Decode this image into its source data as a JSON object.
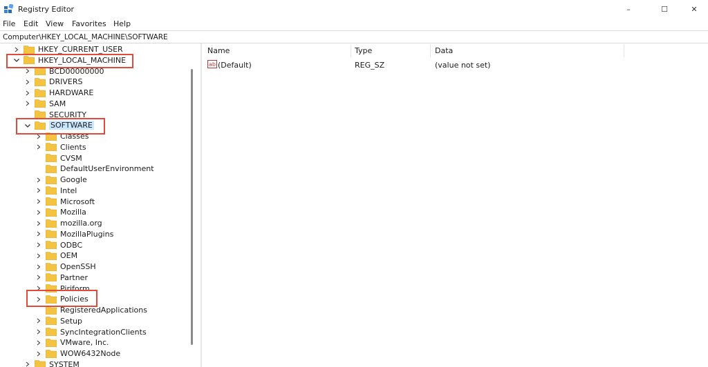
{
  "window": {
    "title": "Registry Editor",
    "controls": {
      "minimize": "–",
      "maximize": "☐",
      "close": "✕"
    }
  },
  "menu": [
    "File",
    "Edit",
    "View",
    "Favorites",
    "Help"
  ],
  "address": "Computer\\HKEY_LOCAL_MACHINE\\SOFTWARE",
  "tree": {
    "items": [
      {
        "label": "HKEY_CURRENT_USER",
        "expanded": false
      },
      {
        "label": "HKEY_LOCAL_MACHINE",
        "expanded": true
      },
      {
        "label": "BCD00000000",
        "expanded": false
      },
      {
        "label": "DRIVERS",
        "expanded": false
      },
      {
        "label": "HARDWARE",
        "expanded": false
      },
      {
        "label": "SAM",
        "expanded": false
      },
      {
        "label": "SECURITY",
        "expanded": false
      },
      {
        "label": "SOFTWARE",
        "expanded": true,
        "selected": true
      },
      {
        "label": "Classes",
        "expanded": false
      },
      {
        "label": "Clients",
        "expanded": false
      },
      {
        "label": "CVSM",
        "expanded": false
      },
      {
        "label": "DefaultUserEnvironment",
        "expanded": false
      },
      {
        "label": "Google",
        "expanded": false
      },
      {
        "label": "Intel",
        "expanded": false
      },
      {
        "label": "Microsoft",
        "expanded": false
      },
      {
        "label": "Mozilla",
        "expanded": false
      },
      {
        "label": "mozilla.org",
        "expanded": false
      },
      {
        "label": "MozillaPlugins",
        "expanded": false
      },
      {
        "label": "ODBC",
        "expanded": false
      },
      {
        "label": "OEM",
        "expanded": false
      },
      {
        "label": "OpenSSH",
        "expanded": false
      },
      {
        "label": "Partner",
        "expanded": false
      },
      {
        "label": "Piriform",
        "expanded": false
      },
      {
        "label": "Policies",
        "expanded": false
      },
      {
        "label": "RegisteredApplications",
        "expanded": false
      },
      {
        "label": "Setup",
        "expanded": false
      },
      {
        "label": "SyncIntegrationClients",
        "expanded": false
      },
      {
        "label": "VMware, Inc.",
        "expanded": false
      },
      {
        "label": "WOW6432Node",
        "expanded": false
      },
      {
        "label": "SYSTEM",
        "expanded": false
      }
    ]
  },
  "list": {
    "columns": [
      "Name",
      "Type",
      "Data"
    ],
    "rows": [
      {
        "name": "(Default)",
        "type": "REG_SZ",
        "data": "(value not set)",
        "icon": "string-value-icon"
      }
    ]
  },
  "colors": {
    "highlight_box": "#e04a3a",
    "folder": "#f3c343",
    "selection": "#cce8ff"
  }
}
